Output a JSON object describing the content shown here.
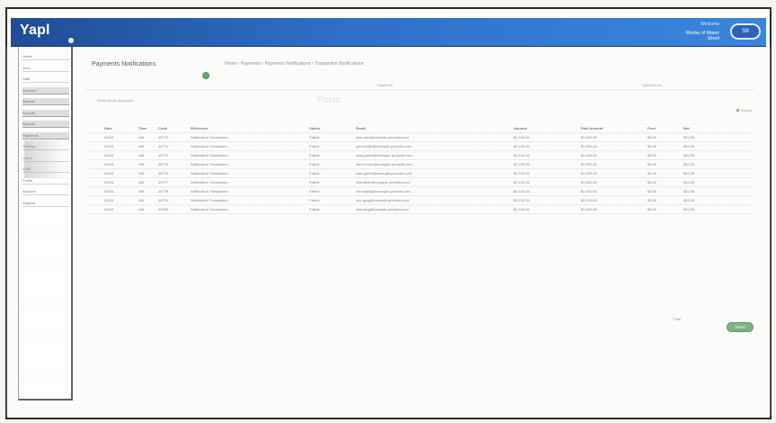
{
  "app": {
    "brand": "Yapl",
    "account_top": "Welcome",
    "account_name": "Wesley of Manor Street",
    "header_button": "SB"
  },
  "sidebar": {
    "items": [
      {
        "label": "Home"
      },
      {
        "label": "Jobs"
      },
      {
        "label": "Staff"
      },
      {
        "label": "Invoices"
      },
      {
        "label": "Reports"
      },
      {
        "label": "Reports"
      },
      {
        "label": "Reports"
      },
      {
        "label": "Payments"
      },
      {
        "label": "Settings"
      },
      {
        "label": "Users"
      },
      {
        "label": "Audit"
      },
      {
        "label": "Profile"
      },
      {
        "label": "Account"
      },
      {
        "label": "Support"
      }
    ]
  },
  "main": {
    "page_title": "Payments Notifications",
    "top_links": "Home › Payments › Payments Notifications › Transaction Notifications",
    "tabs": [
      {
        "label": "Payments"
      },
      {
        "label": "Notifications"
      }
    ],
    "filter_label": "Notifications displayed",
    "watermark": "Poste",
    "side_action": "Export"
  },
  "table": {
    "columns": [
      "Date",
      "Time",
      "Code",
      "Reference",
      "Status",
      "Email",
      "Amount",
      "Paid Amount",
      "Fees",
      "Net"
    ],
    "rows": [
      [
        "01/08",
        "AM",
        "40772",
        "Notification Transaction",
        "Failed",
        "jane.doe@example-provider.com",
        "$2,103.04",
        "$1,920.60",
        "$3.00",
        "$31.05"
      ],
      [
        "01/08",
        "AM",
        "40773",
        "Notification Transaction",
        "Failed",
        "john.smith@example-provider.com",
        "$2,103.04",
        "$1,920.60",
        "$3.00",
        "$31.05"
      ],
      [
        "01/08",
        "AM",
        "40774",
        "Notification Transaction",
        "Failed",
        "mary.jones@example-provider.com",
        "$2,103.04",
        "$1,920.60",
        "$3.00",
        "$31.05"
      ],
      [
        "01/08",
        "AM",
        "40775",
        "Notification Transaction",
        "Failed",
        "alex.brown@example-provider.com",
        "$2,103.04",
        "$1,920.60",
        "$3.00",
        "$31.05"
      ],
      [
        "01/08",
        "AM",
        "40776",
        "Notification Transaction",
        "Failed",
        "sam.green@example-provider.com",
        "$2,103.04",
        "$1,920.60",
        "$3.00",
        "$31.05"
      ],
      [
        "01/08",
        "AM",
        "40777",
        "Notification Transaction",
        "Failed",
        "lisa.white@example-provider.com",
        "$2,103.04",
        "$1,920.60",
        "$3.00",
        "$31.05"
      ],
      [
        "01/08",
        "AM",
        "40778",
        "Notification Transaction",
        "Failed",
        "tom.black@example-provider.com",
        "$2,103.04",
        "$1,920.60",
        "$3.00",
        "$31.05"
      ],
      [
        "01/08",
        "AM",
        "40779",
        "Notification Transaction",
        "Failed",
        "ann.gray@example-provider.com",
        "$2,103.04",
        "$1,920.60",
        "$3.00",
        "$31.05"
      ],
      [
        "01/08",
        "AM",
        "40780",
        "Notification Transaction",
        "Failed",
        "bob.king@example-provider.com",
        "$2,103.04",
        "$1,920.60",
        "$3.00",
        "$31.05"
      ]
    ]
  },
  "footer": {
    "mini_text": "Total",
    "button_label": "Send"
  },
  "colors": {
    "header_blue": "#2f70c9",
    "accent_green": "#5aa064",
    "status_green": "#3a9b42"
  },
  "icons": {
    "green_dot": "status-dot-icon",
    "export_dot": "export-dot-icon"
  }
}
